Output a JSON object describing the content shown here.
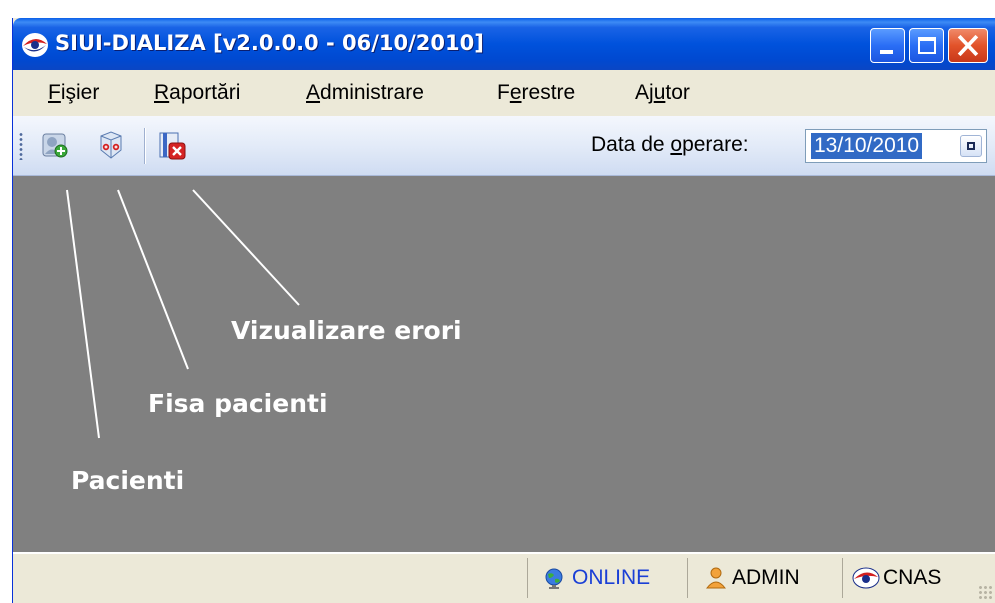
{
  "window": {
    "title": "SIUI-DIALIZA [v2.0.0.0 - 06/10/2010]",
    "app_icon": "cnas-eye-logo-icon",
    "controls": [
      "minimize-icon",
      "maximize-icon",
      "close-icon"
    ]
  },
  "menu": {
    "items": [
      {
        "accel": "F",
        "rest": "işier"
      },
      {
        "accel": "R",
        "rest": "aportări"
      },
      {
        "accel": "A",
        "rest": "dministrare"
      },
      {
        "pre": "F",
        "accel": "e",
        "rest": "restre"
      },
      {
        "pre": "Aj",
        "accel": "u",
        "rest": "tor"
      }
    ]
  },
  "toolbar": {
    "icons": [
      "patients-icon",
      "patient-file-icon",
      "error-view-icon"
    ],
    "date_label_pre": "Data de ",
    "date_label_accel": "o",
    "date_label_rest": "perare:",
    "date_value": "13/10/2010"
  },
  "annotations": {
    "errors": "Vizualizare erori",
    "file": "Fisa pacienti",
    "patients": "Pacienti"
  },
  "statusbar": {
    "online": "ONLINE",
    "user": "ADMIN",
    "org": "CNAS"
  },
  "colors": {
    "title_bar": "#0052dc",
    "client_area": "#808080",
    "selection": "#316ac5",
    "online_text": "#1a3fd6"
  }
}
